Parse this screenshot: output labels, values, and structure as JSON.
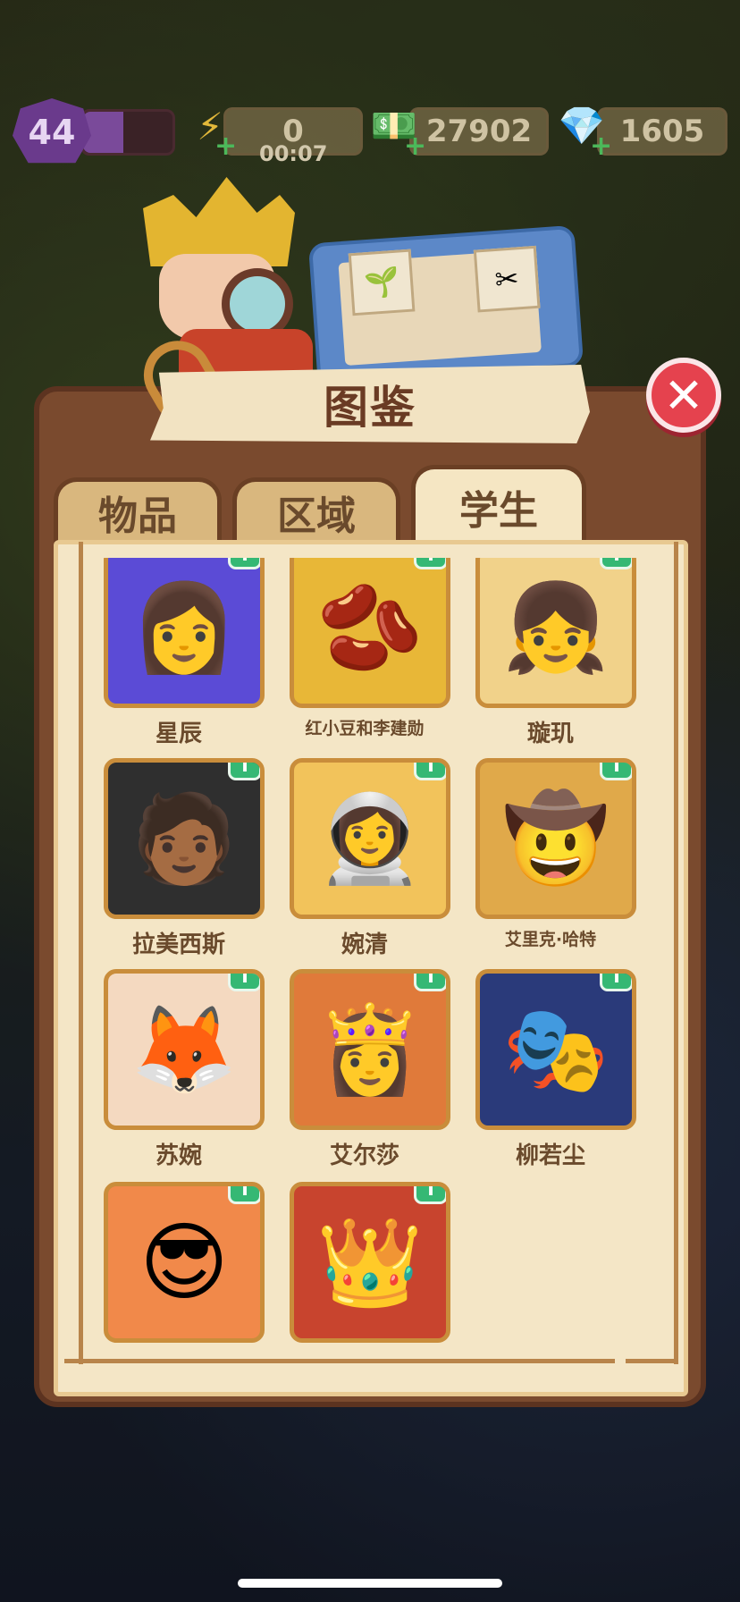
{
  "hud": {
    "level": "44",
    "level_progress": 0.45,
    "energy": "0",
    "energy_timer": "00:07",
    "cash": "27902",
    "gems": "1605"
  },
  "panel": {
    "title": "图鉴",
    "tabs": [
      {
        "label": "物品",
        "active": false
      },
      {
        "label": "区域",
        "active": false
      },
      {
        "label": "学生",
        "active": true
      }
    ]
  },
  "students": [
    {
      "name": "星辰",
      "icon": "starry-girl-avatar",
      "emoji": "👩",
      "bg": "#5b4bd6"
    },
    {
      "name": "红小豆和李建勋",
      "icon": "red-bean-avatar",
      "emoji": "🫘",
      "bg": "#e8b737"
    },
    {
      "name": "璇玑",
      "icon": "bun-hair-girl-avatar",
      "emoji": "👧",
      "bg": "#f1d28a"
    },
    {
      "name": "拉美西斯",
      "icon": "pharaoh-avatar",
      "emoji": "🧑🏾",
      "bg": "#2f2f2f"
    },
    {
      "name": "婉清",
      "icon": "astronaut-girl-avatar",
      "emoji": "👩‍🚀",
      "bg": "#f2c35b"
    },
    {
      "name": "艾里克·哈特",
      "icon": "explorer-avatar",
      "emoji": "🤠",
      "bg": "#e0a94a"
    },
    {
      "name": "苏婉",
      "icon": "fox-mask-girl-avatar",
      "emoji": "🦊",
      "bg": "#f4d9c0"
    },
    {
      "name": "艾尔莎",
      "icon": "white-hair-girl-avatar",
      "emoji": "👸",
      "bg": "#e07a3a"
    },
    {
      "name": "柳若尘",
      "icon": "opera-man-avatar",
      "emoji": "🎭",
      "bg": "#2a3a7a"
    },
    {
      "name": "",
      "icon": "sunglasses-girl-avatar",
      "emoji": "😎",
      "bg": "#f1894a"
    },
    {
      "name": "",
      "icon": "opera-crown-avatar",
      "emoji": "👑",
      "bg": "#c8442e"
    }
  ],
  "icons": {
    "info": "i",
    "close": "✕",
    "energy": "⚡",
    "cash": "💵",
    "gem": "💎",
    "plus": "+"
  }
}
